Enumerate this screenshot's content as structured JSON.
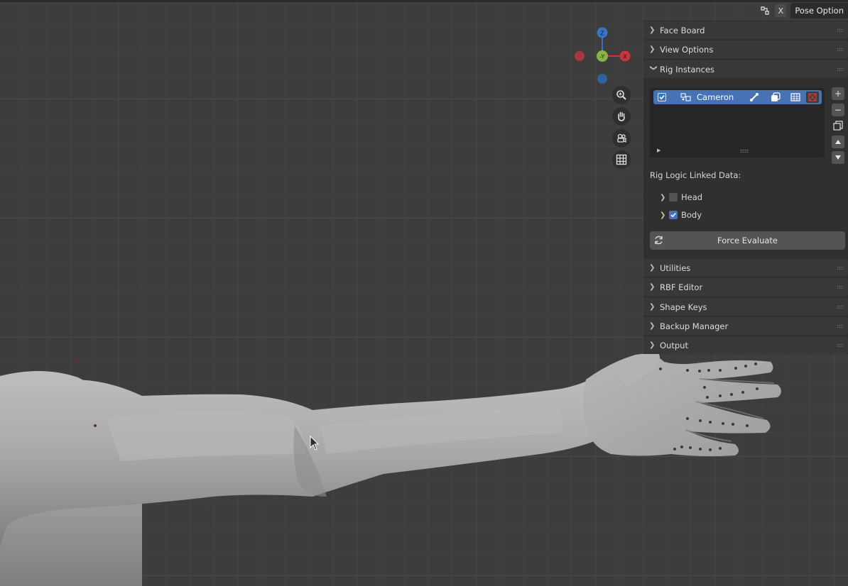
{
  "header": {
    "close_label": "X",
    "tab_label": "Pose Option"
  },
  "gizmo": {
    "axis_z": "Z",
    "axis_y": "-Y",
    "axis_x": "X",
    "colors": {
      "x": "#c5383f",
      "y": "#8ab34c",
      "z": "#3a74c8"
    }
  },
  "nav_icons": [
    "zoom-icon",
    "pan-hand-icon",
    "camera-view-icon",
    "grid-toggle-icon"
  ],
  "panel": {
    "sections_top": [
      {
        "label": "Face Board",
        "expanded": false
      },
      {
        "label": "View Options",
        "expanded": false
      },
      {
        "label": "Rig Instances",
        "expanded": true
      }
    ],
    "rig_instances": {
      "items": [
        {
          "name": "Cameron",
          "enabled": true,
          "selected": true
        }
      ],
      "linked_data_label": "Rig Logic Linked Data:",
      "linked": [
        {
          "label": "Head",
          "checked": false
        },
        {
          "label": "Body",
          "checked": true
        }
      ],
      "force_evaluate_label": "Force Evaluate"
    },
    "sections_bottom": [
      {
        "label": "Utilities"
      },
      {
        "label": "RBF Editor"
      },
      {
        "label": "Shape Keys"
      },
      {
        "label": "Backup Manager"
      },
      {
        "label": "Output"
      }
    ]
  },
  "accent_color": "#4772b3"
}
